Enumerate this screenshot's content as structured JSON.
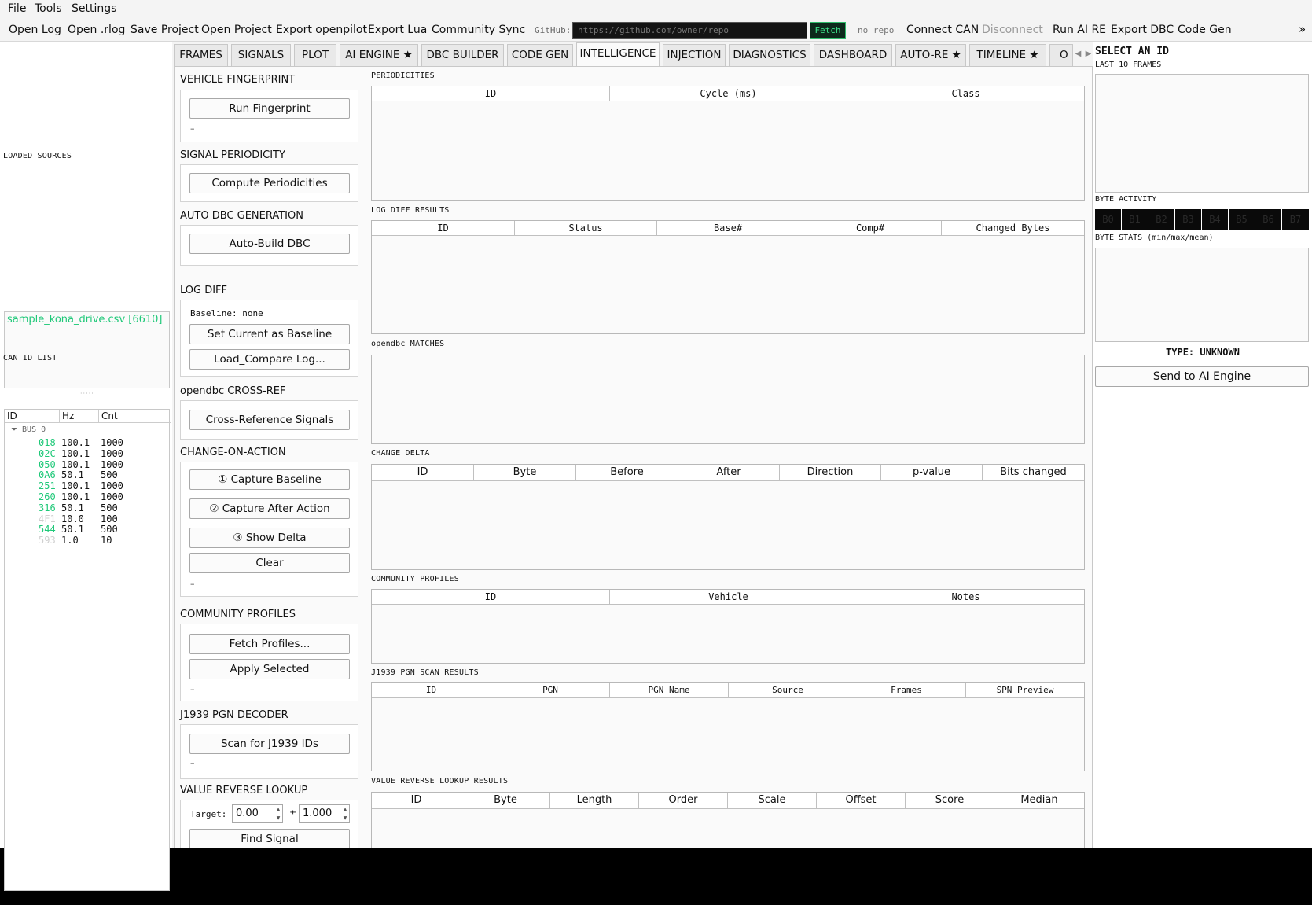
{
  "menu": [
    "File",
    "Tools",
    "Settings"
  ],
  "toolbar": {
    "buttons": [
      "Open Log",
      "Open .rlog",
      "Save Project",
      "Open Project",
      "Export openpilot",
      "Export Lua",
      "Community Sync"
    ],
    "github_label": "GitHub:",
    "github_placeholder": "https://github.com/owner/repo",
    "fetch_label": "Fetch",
    "repo_status": "no repo",
    "connect_can": "Connect CAN",
    "disconnect": "Disconnect",
    "run_ai_re": "Run AI RE",
    "export_dbc": "Export DBC",
    "code_gen": "Code Gen",
    "overflow": "»"
  },
  "left": {
    "loaded_sources_label": "LOADED SOURCES",
    "sources": [
      "sample_kona_drive.csv  [6610]"
    ],
    "can_id_list_label": "CAN ID LIST",
    "columns": [
      "ID",
      "Hz",
      "Cnt"
    ],
    "bus_label": "BUS 0",
    "rows": [
      {
        "id": "018",
        "hz": "100.1",
        "cnt": "1000",
        "color": "#1ec878"
      },
      {
        "id": "02C",
        "hz": "100.1",
        "cnt": "1000",
        "color": "#1ec878"
      },
      {
        "id": "050",
        "hz": "100.1",
        "cnt": "1000",
        "color": "#1ec878"
      },
      {
        "id": "0A6",
        "hz": "50.1",
        "cnt": "500",
        "color": "#1ec878"
      },
      {
        "id": "251",
        "hz": "100.1",
        "cnt": "1000",
        "color": "#1ec878"
      },
      {
        "id": "260",
        "hz": "100.1",
        "cnt": "1000",
        "color": "#1ec878"
      },
      {
        "id": "316",
        "hz": "50.1",
        "cnt": "500",
        "color": "#1ec878"
      },
      {
        "id": "4F1",
        "hz": "10.0",
        "cnt": "100",
        "color": "#cfcfcf"
      },
      {
        "id": "544",
        "hz": "50.1",
        "cnt": "500",
        "color": "#1ec878"
      },
      {
        "id": "593",
        "hz": "1.0",
        "cnt": "10",
        "color": "#cfcfcf"
      }
    ]
  },
  "tabs": [
    "FRAMES",
    "SIGNALS",
    "PLOT",
    "AI ENGINE ★",
    "DBC BUILDER",
    "CODE GEN",
    "INTELLIGENCE",
    "INJECTION",
    "DIAGNOSTICS",
    "DASHBOARD",
    "AUTO-RE ★",
    "TIMELINE ★",
    "O"
  ],
  "active_tab": "INTELLIGENCE",
  "intel": {
    "fingerprint": {
      "title": "VEHICLE FINGERPRINT",
      "button": "Run Fingerprint",
      "status": "–"
    },
    "periodicity": {
      "title": "SIGNAL PERIODICITY",
      "button": "Compute Periodicities"
    },
    "autodbc": {
      "title": "AUTO DBC GENERATION",
      "button": "Auto-Build DBC"
    },
    "logdiff": {
      "title": "LOG DIFF",
      "baseline": "Baseline: none",
      "btn1": "Set Current as Baseline",
      "btn2": "Load_Compare Log..."
    },
    "crossref": {
      "title": "opendbc CROSS-REF",
      "button": "Cross-Reference Signals"
    },
    "coa": {
      "title": "CHANGE-ON-ACTION",
      "btn1": "① Capture Baseline",
      "btn2": "② Capture After Action",
      "btn3": "③ Show Delta",
      "btn4": "Clear",
      "status": "–"
    },
    "community": {
      "title": "COMMUNITY PROFILES",
      "btn1": "Fetch Profiles...",
      "btn2": "Apply Selected",
      "status": "–"
    },
    "j1939": {
      "title": "J1939 PGN DECODER",
      "button": "Scan for J1939 IDs",
      "status": "–"
    },
    "vrl": {
      "title": "VALUE REVERSE LOOKUP",
      "target_label": "Target:",
      "target_value": "0.00",
      "pm": "±",
      "tol_value": "1.000",
      "button": "Find Signal"
    }
  },
  "results": {
    "periodicities": {
      "title": "PERIODICITIES",
      "columns": [
        "ID",
        "Cycle (ms)",
        "Class"
      ]
    },
    "logdiff": {
      "title": "LOG DIFF RESULTS",
      "columns": [
        "ID",
        "Status",
        "Base#",
        "Comp#",
        "Changed Bytes"
      ]
    },
    "opendbc": {
      "title": "opendbc MATCHES"
    },
    "delta": {
      "title": "CHANGE DELTA",
      "columns": [
        "ID",
        "Byte",
        "Before",
        "After",
        "Direction",
        "p-value",
        "Bits changed"
      ]
    },
    "community": {
      "title": "COMMUNITY PROFILES",
      "columns": [
        "ID",
        "Vehicle",
        "Notes"
      ]
    },
    "j1939": {
      "title": "J1939 PGN SCAN RESULTS",
      "columns": [
        "ID",
        "PGN",
        "PGN Name",
        "Source",
        "Frames",
        "SPN Preview"
      ]
    },
    "vrl": {
      "title": "VALUE REVERSE LOOKUP RESULTS",
      "columns": [
        "ID",
        "Byte",
        "Length",
        "Order",
        "Scale",
        "Offset",
        "Score",
        "Median"
      ]
    }
  },
  "right": {
    "title": "SELECT AN ID",
    "last_frames": "LAST 10 FRAMES",
    "byte_activity": "BYTE ACTIVITY",
    "bytes": [
      "B0",
      "B1",
      "B2",
      "B3",
      "B4",
      "B5",
      "B6",
      "B7"
    ],
    "byte_stats": "BYTE STATS (min/max/mean)",
    "type": "TYPE: UNKNOWN",
    "send": "Send to AI Engine"
  }
}
